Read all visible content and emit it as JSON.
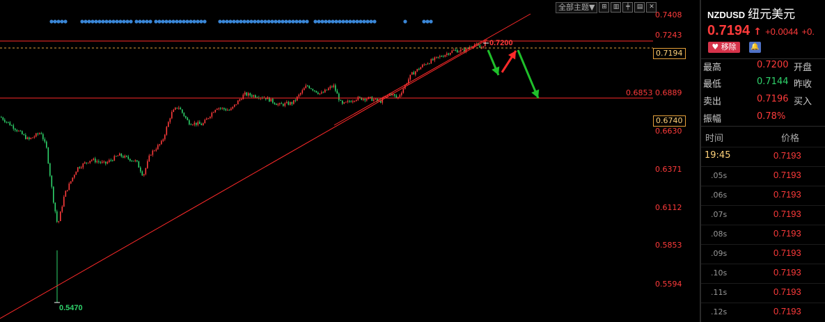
{
  "toolbar": {
    "theme_label": "全部主题▼",
    "icons": [
      "expand-icon",
      "indicator-icon",
      "crosshair-icon",
      "ruler-icon",
      "close-icon"
    ]
  },
  "chart": {
    "right_axis_labels": [
      "0.7408",
      "0.7243",
      "0.6889",
      "0.6630",
      "0.6371",
      "0.6112",
      "0.5853",
      "0.5594"
    ],
    "resistance_level": "0.6853",
    "current_price_box": "0.7194",
    "cursor_price_box": "0.6740",
    "high_marker": "0.7200",
    "low_marker": "0.5470"
  },
  "quote": {
    "symbol": "NZDUSD",
    "name": "纽元美元",
    "price": "0.7194",
    "change": "+0.0044",
    "change_pct": "+0.",
    "remove_label": "移除",
    "stats": [
      {
        "label": "最高",
        "value": "0.7200",
        "color": "red",
        "extra": "开盘"
      },
      {
        "label": "最低",
        "value": "0.7144",
        "color": "green",
        "extra": "昨收"
      },
      {
        "label": "卖出",
        "value": "0.7196",
        "color": "red",
        "extra": "买入"
      },
      {
        "label": "振幅",
        "value": "0.78%",
        "color": "red",
        "extra": ""
      }
    ]
  },
  "ticks": {
    "header_time": "时间",
    "header_price": "价格",
    "rows": [
      {
        "time": "19:45",
        "price": "0.7193"
      },
      {
        "time": ".05s",
        "price": "0.7193"
      },
      {
        "time": ".06s",
        "price": "0.7193"
      },
      {
        "time": ".07s",
        "price": "0.7193"
      },
      {
        "time": ".08s",
        "price": "0.7193"
      },
      {
        "time": ".09s",
        "price": "0.7193"
      },
      {
        "time": ".10s",
        "price": "0.7193"
      },
      {
        "time": ".11s",
        "price": "0.7193"
      },
      {
        "time": ".12s",
        "price": "0.7193"
      }
    ]
  },
  "colors": {
    "up": "#ff3b3b",
    "down": "#2fd36b",
    "trendline": "#ff2a2a",
    "event_dots": "#3a86d6",
    "annotation_green": "#1fbf2a",
    "annotation_red": "#ff2a2a",
    "box_border": "#e8a23b"
  }
}
